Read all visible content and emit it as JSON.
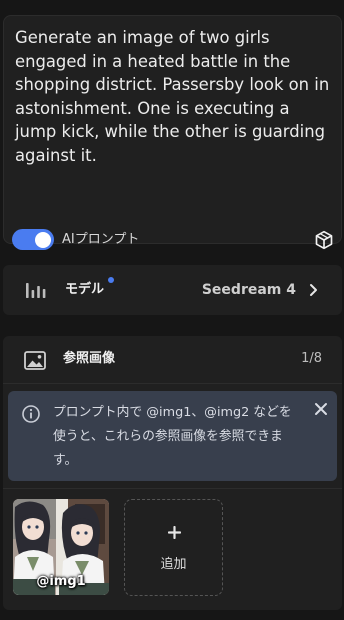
{
  "prompt": {
    "text": "Generate an image of two girls engaged in a heated battle in the shopping district. Passersby look on in astonishment. One is executing a jump kick, while the other is guarding against it.",
    "ai_prompt_label": "AIプロンプト",
    "ai_prompt_enabled": true
  },
  "model": {
    "label": "モデル",
    "value": "Seedream 4"
  },
  "reference": {
    "title": "参照画像",
    "count": "1/8",
    "info_text": "プロンプト内で @img1、@img2 などを使うと、これらの参照画像を参照できます。",
    "images": [
      {
        "label": "@img1"
      }
    ],
    "add_label": "追加"
  },
  "colors": {
    "accent": "#4a7cf0",
    "panel": "#202020",
    "background": "#161616",
    "info_bg": "#383f4d"
  }
}
